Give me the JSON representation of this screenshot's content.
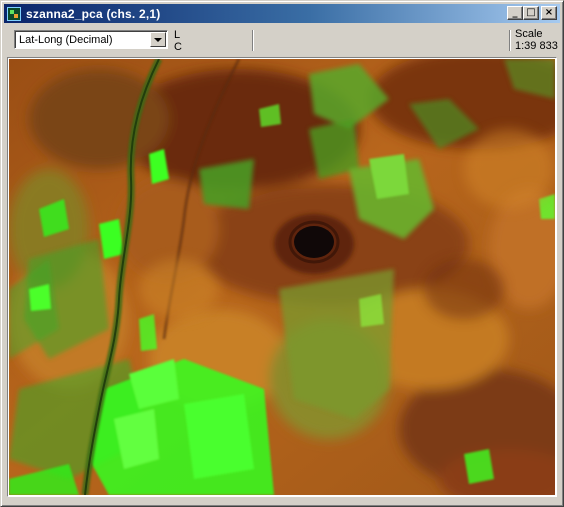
{
  "window": {
    "title": "szanna2_pca (chs. 2,1)",
    "controls": {
      "minimize": "_",
      "maximize": "□",
      "close": "×"
    }
  },
  "toolbar": {
    "coordinate_system": "Lat-Long (Decimal)",
    "line_label": "L",
    "column_label": "C",
    "scale_label": "Scale",
    "scale_value": "1:39 833"
  },
  "icons": [
    "app-icon",
    "chevron-down-icon",
    "minimize-icon",
    "maximize-icon",
    "close-icon"
  ],
  "colors": {
    "title_gradient_start": "#0a246a",
    "title_gradient_end": "#a6caf0",
    "image_base": "#b8661c",
    "vegetation_green": "#3cff2c",
    "dark_ridge": "#6a2a08"
  }
}
